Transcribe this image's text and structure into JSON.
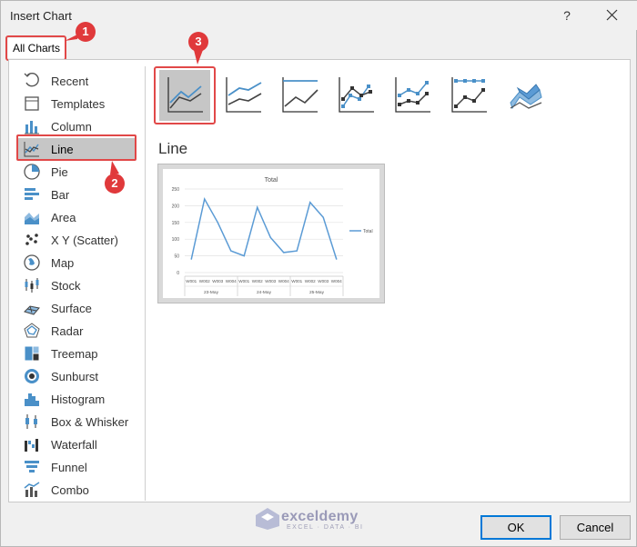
{
  "dialog": {
    "title": "Insert Chart",
    "help_label": "?",
    "tab_label": "All Charts",
    "section_title": "Line",
    "ok_label": "OK",
    "cancel_label": "Cancel"
  },
  "badges": {
    "one": "1",
    "two": "2",
    "three": "3"
  },
  "sidebar": {
    "items": [
      {
        "label": "Recent",
        "icon": "recent-icon"
      },
      {
        "label": "Templates",
        "icon": "templates-icon"
      },
      {
        "label": "Column",
        "icon": "column-icon"
      },
      {
        "label": "Line",
        "icon": "line-icon",
        "selected": true
      },
      {
        "label": "Pie",
        "icon": "pie-icon"
      },
      {
        "label": "Bar",
        "icon": "bar-icon"
      },
      {
        "label": "Area",
        "icon": "area-icon"
      },
      {
        "label": "X Y (Scatter)",
        "icon": "scatter-icon"
      },
      {
        "label": "Map",
        "icon": "map-icon"
      },
      {
        "label": "Stock",
        "icon": "stock-icon"
      },
      {
        "label": "Surface",
        "icon": "surface-icon"
      },
      {
        "label": "Radar",
        "icon": "radar-icon"
      },
      {
        "label": "Treemap",
        "icon": "treemap-icon"
      },
      {
        "label": "Sunburst",
        "icon": "sunburst-icon"
      },
      {
        "label": "Histogram",
        "icon": "histogram-icon"
      },
      {
        "label": "Box & Whisker",
        "icon": "box-whisker-icon"
      },
      {
        "label": "Waterfall",
        "icon": "waterfall-icon"
      },
      {
        "label": "Funnel",
        "icon": "funnel-icon"
      },
      {
        "label": "Combo",
        "icon": "combo-icon"
      }
    ]
  },
  "subtypes": [
    {
      "icon": "line-subtype-icon",
      "selected": true
    },
    {
      "icon": "stacked-line-subtype-icon"
    },
    {
      "icon": "100-stacked-line-subtype-icon"
    },
    {
      "icon": "line-markers-subtype-icon"
    },
    {
      "icon": "stacked-line-markers-subtype-icon"
    },
    {
      "icon": "100-stacked-line-markers-subtype-icon"
    },
    {
      "icon": "3d-line-subtype-icon"
    }
  ],
  "logo": {
    "name": "exceldemy",
    "tagline": "EXCEL · DATA · BI"
  },
  "colors": {
    "accent_blue": "#0078d7",
    "highlight_red": "#e14848",
    "series_blue": "#5b9bd5"
  },
  "chart_data": {
    "type": "line",
    "title": "Total",
    "categories": [
      "W001",
      "W002",
      "W003",
      "W004",
      "W001",
      "W002",
      "W003",
      "W004",
      "W001",
      "W002",
      "W003",
      "W004"
    ],
    "groups": [
      "23-May",
      "24-May",
      "25-May"
    ],
    "series": [
      {
        "name": "Total",
        "values": [
          40,
          220,
          150,
          65,
          50,
          195,
          105,
          60,
          65,
          210,
          165,
          40
        ]
      }
    ],
    "yticks": [
      "0",
      "50",
      "100",
      "150",
      "200",
      "250"
    ],
    "ylim": [
      0,
      250
    ],
    "legend": "right",
    "grid": true
  }
}
